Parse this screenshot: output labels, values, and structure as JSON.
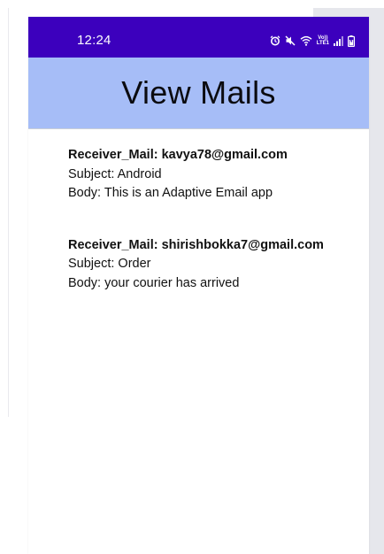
{
  "status_bar": {
    "time": "12:24",
    "lte_label_top": "Vo))",
    "lte_label_bottom": "LTE1"
  },
  "app_bar": {
    "title": "View Mails"
  },
  "mails": [
    {
      "receiver": "Receiver_Mail: kavya78@gmail.com",
      "subject": "Subject: Android",
      "body": "Body: This is an Adaptive Email app"
    },
    {
      "receiver": "Receiver_Mail: shirishbokka7@gmail.com",
      "subject": "Subject: Order",
      "body": "Body: your courier has arrived"
    }
  ],
  "colors": {
    "status_bar": "#3c00bd",
    "app_bar": "#a6bdf7"
  },
  "icons": [
    "alarm-icon",
    "mute-icon",
    "wifi-icon",
    "volte-lte-icon",
    "signal-icon",
    "battery-icon"
  ]
}
